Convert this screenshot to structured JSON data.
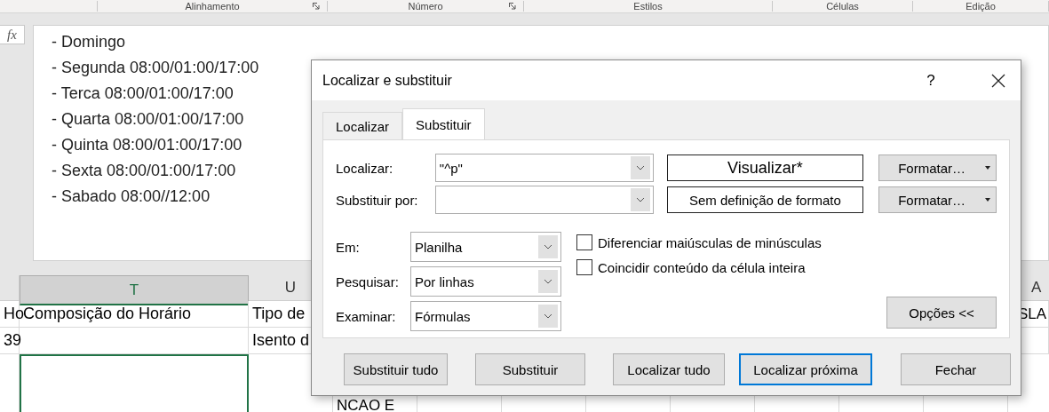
{
  "ribbon_groups": [
    {
      "label": "Alinhamento",
      "launcher": true
    },
    {
      "label": "Número",
      "launcher": true
    },
    {
      "label": "Estilos",
      "launcher": false
    },
    {
      "label": "Células",
      "launcher": false
    },
    {
      "label": "Edição",
      "launcher": false
    }
  ],
  "formula_bar": {
    "button": "fx",
    "lines": [
      "- Domingo",
      "- Segunda 08:00/01:00/17:00",
      "- Terca 08:00/01:00/17:00",
      "- Quarta 08:00/01:00/17:00",
      "- Quinta 08:00/01:00/17:00",
      "- Sexta 08:00/01:00/17:00",
      "- Sabado 08:00//12:00"
    ]
  },
  "sheet": {
    "column_headers": [
      {
        "label": "T",
        "selected": true
      },
      {
        "label": "U",
        "selected": false
      },
      {
        "label": "A",
        "selected": false
      }
    ],
    "rows": [
      [
        "Ho",
        "Composição do Horário",
        "Tipo de",
        "SLA"
      ],
      [
        "39",
        "",
        "Isento d",
        ""
      ]
    ],
    "below_dialog": "NCAO E"
  },
  "dialog": {
    "title": "Localizar e substituir",
    "help": "?",
    "tabs": [
      {
        "label": "Localizar",
        "selected": false
      },
      {
        "label": "Substituir",
        "selected": true
      }
    ],
    "find": {
      "label": "Localizar:",
      "value": "\"^p\"",
      "preview": "Visualizar*",
      "format_button": "Formatar…"
    },
    "replace": {
      "label": "Substituir por:",
      "preview": "Sem definição de formato",
      "format_button": "Formatar…"
    },
    "selects": [
      {
        "label": "Em:",
        "value": "Planilha"
      },
      {
        "label": "Pesquisar:",
        "value": "Por linhas"
      },
      {
        "label": "Examinar:",
        "value": "Fórmulas"
      }
    ],
    "checkboxes": [
      {
        "label": "Diferenciar maiúsculas de minúsculas",
        "checked": false
      },
      {
        "label": "Coincidir conteúdo da célula inteira",
        "checked": false
      }
    ],
    "options_button": "Opções <<",
    "buttons": [
      {
        "label": "Substituir tudo",
        "default": false
      },
      {
        "label": "Substituir",
        "default": false
      },
      {
        "label": "Localizar tudo",
        "default": false
      },
      {
        "label": "Localizar próxima",
        "default": true
      },
      {
        "label": "Fechar",
        "default": false
      }
    ]
  }
}
